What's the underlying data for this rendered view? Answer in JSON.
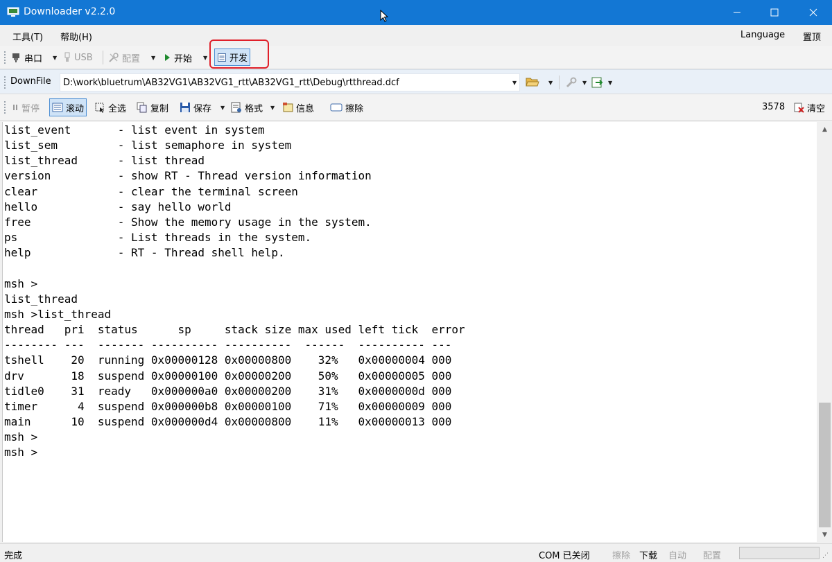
{
  "window": {
    "title": "Downloader v2.2.0"
  },
  "menu": {
    "tools": "工具(T)",
    "help": "帮助(H)",
    "language": "Language",
    "top": "置顶"
  },
  "toolbar1": {
    "serial": "串口",
    "usb": "USB",
    "config": "配置",
    "start": "开始",
    "develop": "开发"
  },
  "toolbar2": {
    "downfile_label": "DownFile",
    "path": "D:\\work\\bluetrum\\AB32VG1\\AB32VG1_rtt\\AB32VG1_rtt\\Debug\\rtthread.dcf"
  },
  "toolbar3": {
    "pause": "暂停",
    "scroll": "滚动",
    "select_all": "全选",
    "copy": "复制",
    "save": "保存",
    "format": "格式",
    "info": "信息",
    "erase": "擦除",
    "count": "3578",
    "clear": "清空"
  },
  "terminal": {
    "text": "list_event       - list event in system\nlist_sem         - list semaphore in system\nlist_thread      - list thread\nversion          - show RT - Thread version information\nclear            - clear the terminal screen\nhello            - say hello world\nfree             - Show the memory usage in the system.\nps               - List threads in the system.\nhelp             - RT - Thread shell help.\n\nmsh >\nlist_thread\nmsh >list_thread\nthread   pri  status      sp     stack size max used left tick  error\n-------- ---  ------- ---------- ----------  ------  ---------- ---\ntshell    20  running 0x00000128 0x00000800    32%   0x00000004 000\ndrv       18  suspend 0x00000100 0x00000200    50%   0x00000005 000\ntidle0    31  ready   0x000000a0 0x00000200    31%   0x0000000d 000\ntimer      4  suspend 0x000000b8 0x00000100    71%   0x00000009 000\nmain      10  suspend 0x000000d4 0x00000800    11%   0x00000013 000\nmsh >\nmsh >"
  },
  "statusbar": {
    "status": "完成",
    "com": "COM 已关闭",
    "erase": "擦除",
    "download": "下载",
    "auto": "自动",
    "config": "配置"
  },
  "icons": {
    "app": "downloader-app-icon",
    "serial": "plug-icon",
    "usb": "usb-icon",
    "config": "tools-icon",
    "start": "play-icon",
    "develop": "document-icon",
    "folder": "folder-open-icon",
    "wrench": "wrench-icon",
    "export": "export-icon",
    "pause": "pause-icon",
    "scroll": "scroll-icon",
    "select_all": "select-all-icon",
    "copy": "copy-icon",
    "save": "save-icon",
    "format": "format-icon",
    "info": "info-icon",
    "erase": "eraser-icon",
    "clear": "clear-icon"
  },
  "colors": {
    "titlebar": "#1377d4",
    "highlight": "#e0202a"
  }
}
